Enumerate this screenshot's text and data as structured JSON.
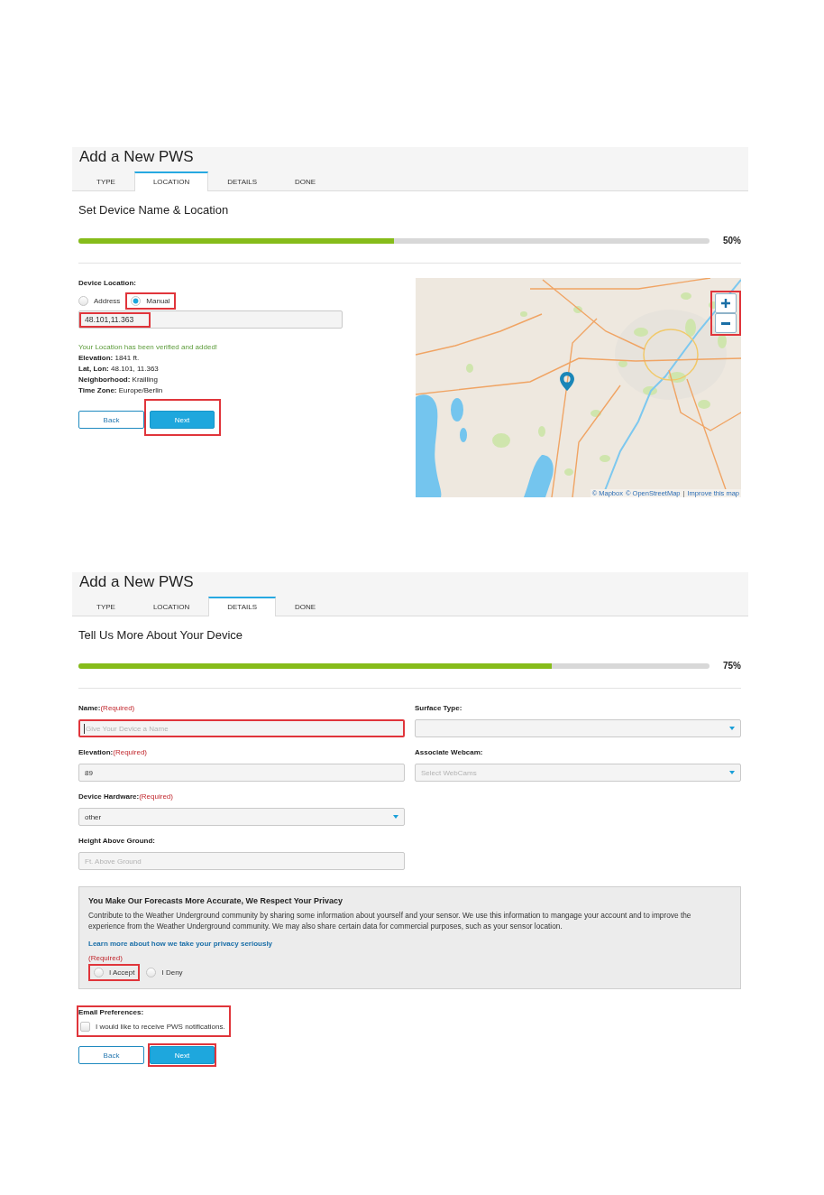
{
  "screens": [
    {
      "kind": "location",
      "title": "Add a New PWS",
      "tabs": [
        {
          "label": "TYPE",
          "selected": false
        },
        {
          "label": "LOCATION",
          "selected": true
        },
        {
          "label": "DETAILS",
          "selected": false
        },
        {
          "label": "DONE",
          "selected": false
        }
      ],
      "heading": "Set Device Name & Location",
      "progress": {
        "level": 0.5,
        "reading": "50%"
      },
      "location": {
        "label": "Device Location:",
        "options": [
          {
            "label": "Address",
            "selected": false,
            "highlighted": false
          },
          {
            "label": "Manual",
            "selected": true,
            "highlighted": true
          }
        ],
        "field": {
          "kind": "text",
          "value": "48.101,11.363",
          "value_highlighted": true
        },
        "status": "Your Location has been verified and added!",
        "details": [
          "**Elevation:** 1841 ft.",
          "**Lat, Lon:** 48.101, 11.363",
          "**Neighborhood:** Krailling",
          "**Time Zone:** Europe/Berlin"
        ]
      },
      "map": {
        "controls_highlighted": true,
        "attribution": [
          {
            "kind": "link",
            "text": "© Mapbox"
          },
          {
            "kind": "link",
            "text": "© OpenStreetMap"
          },
          {
            "kind": "separator",
            "text": "|"
          },
          {
            "kind": "link",
            "text": "Improve this map"
          }
        ]
      },
      "buttons": [
        {
          "kind": "back",
          "label": "Back",
          "highlighted": false
        },
        {
          "kind": "next",
          "label": "Next",
          "highlighted": true
        }
      ]
    },
    {
      "kind": "details",
      "title": "Add a New PWS",
      "tabs": [
        {
          "label": "TYPE",
          "selected": false
        },
        {
          "label": "LOCATION",
          "selected": false
        },
        {
          "label": "DETAILS",
          "selected": true
        },
        {
          "label": "DONE",
          "selected": false
        }
      ],
      "heading": "Tell Us More About Your Device",
      "progress": {
        "level": 0.75,
        "reading": "75%"
      },
      "fields_left": [
        {
          "kind": "text",
          "label": "Name:",
          "required_note": "(Required)",
          "placeholder": "Give Your Device a Name",
          "focused": true,
          "highlighted": true
        },
        {
          "kind": "text",
          "label": "Elevation:",
          "required_note": "(Required)",
          "value": "89",
          "focused": false,
          "highlighted": false
        },
        {
          "kind": "select",
          "label": "Device Hardware:",
          "required_note": "(Required)",
          "value": "other",
          "focused": false,
          "highlighted": false
        },
        {
          "kind": "text",
          "label": "Height Above Ground:",
          "placeholder": "Ft. Above Ground",
          "focused": false,
          "highlighted": false
        }
      ],
      "fields_right": [
        {
          "kind": "select",
          "label": "Surface Type:",
          "focused": false,
          "highlighted": false
        },
        {
          "kind": "select",
          "label": "Associate Webcam:",
          "placeholder": "Select WebCams",
          "focused": false,
          "highlighted": false
        }
      ],
      "privacy": {
        "title": "You Make Our Forecasts More Accurate, We Respect Your Privacy",
        "text": "Contribute to the Weather Underground community by sharing some information about yourself and your sensor. We use this information to mangage your account and to improve the experience from the Weather Underground community. We may also share certain data for commercial purposes, such as your sensor location.",
        "link": "Learn more about how we take your privacy seriously",
        "required_note": "(Required)",
        "options": [
          {
            "label": "I Accept",
            "selected": false,
            "highlighted": true
          },
          {
            "label": "I Deny",
            "selected": false,
            "highlighted": false
          }
        ]
      },
      "email": {
        "label": "Email Preferences:",
        "highlighted": true,
        "option": {
          "label": "I would like to receive PWS notifications.",
          "checked": false
        }
      },
      "buttons": [
        {
          "kind": "back",
          "label": "Back",
          "highlighted": false
        },
        {
          "kind": "next",
          "label": "Next",
          "highlighted": true
        }
      ]
    }
  ]
}
